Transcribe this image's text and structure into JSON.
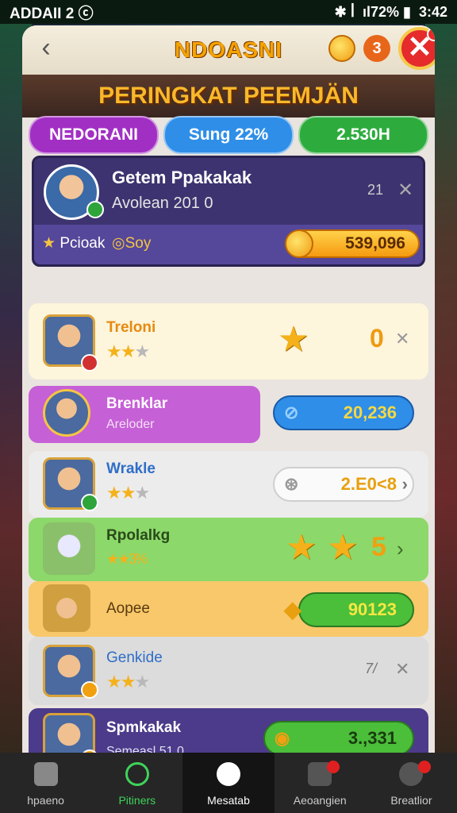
{
  "status": {
    "left": "ADDAII 2 ⓒ",
    "right_icons": "✱ ꟾ",
    "battery": "ıl72% ▮",
    "time": "3:42"
  },
  "header": {
    "title": "NDOASNI",
    "badge_count": "3",
    "close": "✕"
  },
  "banner": {
    "title": "PERINGKAT PEEMJÄN"
  },
  "tabs": [
    {
      "label": "NEDORANI",
      "color": "#a22fc4"
    },
    {
      "label": "Sung 22%",
      "color": "#2f8ee8"
    },
    {
      "label": "2.530H",
      "color": "#2dac3d"
    }
  ],
  "profile": {
    "name": "Getem Ppakakak",
    "subtitle": "Avolean 201 0",
    "rank": "21",
    "close": "✕",
    "label1": "Pcioak",
    "label2": "Soy",
    "score": "539,096"
  },
  "rows": [
    {
      "name": "Treloni",
      "stars": 2,
      "value": "0",
      "close": "✕",
      "bg": "#fdf5dc"
    },
    {
      "name": "Brenklar",
      "subtitle": "Areloder",
      "value": "20,236",
      "bg": "#c660d6"
    },
    {
      "name": "Wrakle",
      "stars": 2,
      "value": "2.E0<8",
      "arrow": "›",
      "bg": "#ececec"
    },
    {
      "name": "Rpolalkg",
      "stars_text": "★★3%",
      "value": "5",
      "arrow": "›",
      "bg": "#8cd86a"
    },
    {
      "name": "Aopee",
      "value": "90123",
      "bg": "#f8c86a"
    },
    {
      "name": "Genkide",
      "stars": 2,
      "value": "7/",
      "close": "✕",
      "bg": "#dcdcdc"
    },
    {
      "name": "Spmkakak",
      "subtitle": "Semeasl 51 0",
      "value": "3.,331",
      "bg": "#4c3a8a"
    }
  ],
  "nav": [
    {
      "label": "hpaeno"
    },
    {
      "label": "Pitiners"
    },
    {
      "label": "Mesatab"
    },
    {
      "label": "Aeoangien"
    },
    {
      "label": "Breatlior"
    }
  ]
}
